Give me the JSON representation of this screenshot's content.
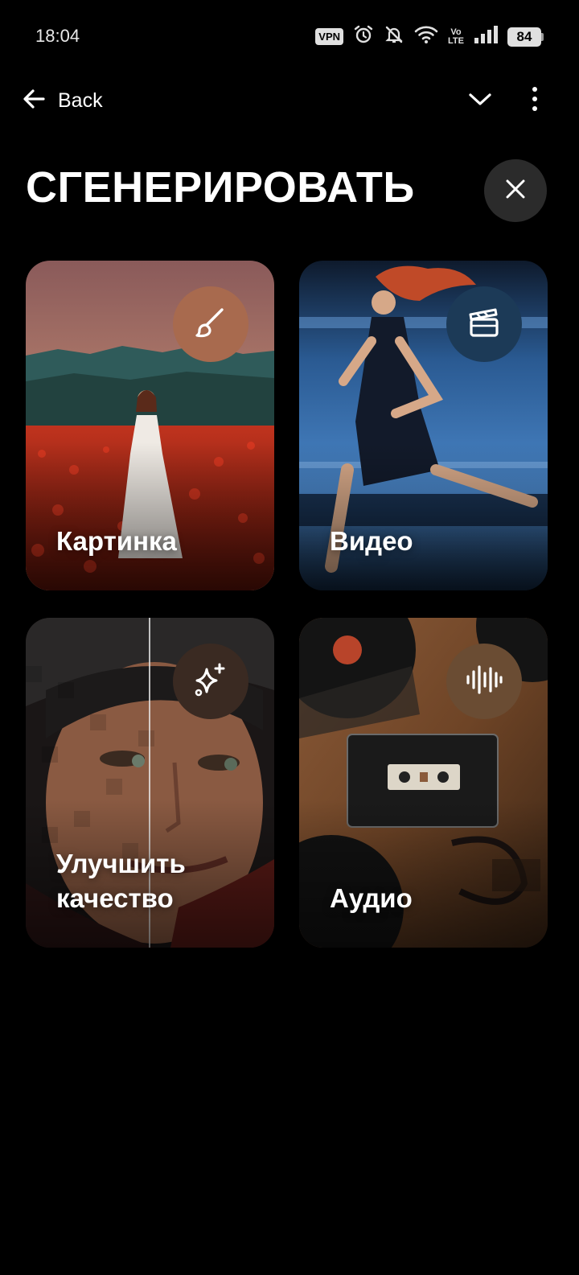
{
  "status_bar": {
    "time": "18:04",
    "vpn": "VPN",
    "volte_top": "Vo",
    "volte_bottom": "LTE",
    "battery": "84",
    "icons": [
      "alarm-icon",
      "bell-muted-icon",
      "wifi-icon",
      "signal-icon",
      "battery-icon"
    ]
  },
  "app_bar": {
    "back_label": "Back",
    "icons": [
      "arrow-left-icon",
      "chevron-down-icon",
      "more-vertical-icon"
    ]
  },
  "page": {
    "title": "СГЕНЕРИРОВАТЬ",
    "close_icon": "close-icon"
  },
  "cards": [
    {
      "label": "Картинка",
      "icon": "paintbrush-icon",
      "badge_color": "#a86a4e"
    },
    {
      "label": "Видео",
      "icon": "clapperboard-icon",
      "badge_color": "#1c3a57"
    },
    {
      "label": "Улучшить качество",
      "label_line1": "Улучшить",
      "label_line2": "качество",
      "icon": "sparkles-icon",
      "badge_color": "#3a2a22"
    },
    {
      "label": "Аудио",
      "icon": "audio-waveform-icon",
      "badge_color": "#6a4c33"
    }
  ],
  "colors": {
    "background": "#000000",
    "close_button_bg": "#2b2b2b",
    "text": "#ffffff"
  }
}
